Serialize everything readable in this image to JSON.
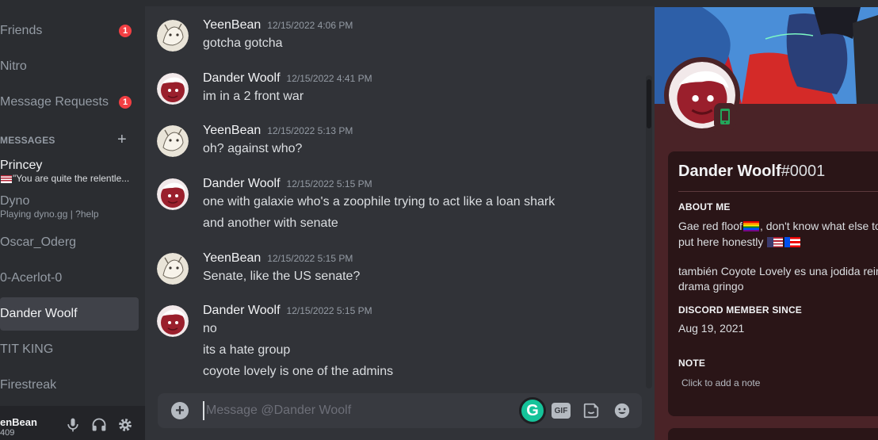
{
  "sidebar": {
    "nav": [
      {
        "label": "Friends",
        "badge": "1"
      },
      {
        "label": "Nitro",
        "badge": null
      },
      {
        "label": "Message Requests",
        "badge": "1"
      }
    ],
    "dm_header": "MESSAGES",
    "dms": [
      {
        "name": "Princey",
        "sub": "\"You are quite the relentle..."
      },
      {
        "name": "Dyno",
        "sub": "Playing dyno.gg | ?help"
      },
      {
        "name": "Oscar_Oderg",
        "sub": ""
      },
      {
        "name": "0-Acerlot-0",
        "sub": ""
      },
      {
        "name": "Dander Woolf",
        "sub": ""
      },
      {
        "name": "TIT KING",
        "sub": ""
      },
      {
        "name": "Firestreak",
        "sub": ""
      }
    ],
    "user": {
      "name": "enBean",
      "tag": "409"
    }
  },
  "messages": [
    {
      "author": "YeenBean",
      "time": "12/15/2022 4:06 PM",
      "lines": [
        "gotcha gotcha"
      ]
    },
    {
      "author": "Dander Woolf",
      "time": "12/15/2022 4:41 PM",
      "lines": [
        "im in a 2 front war"
      ]
    },
    {
      "author": "YeenBean",
      "time": "12/15/2022 5:13 PM",
      "lines": [
        "oh? against who?"
      ]
    },
    {
      "author": "Dander Woolf",
      "time": "12/15/2022 5:15 PM",
      "lines": [
        "one with galaxie who's a zoophile trying to act like a loan shark",
        "and another with senate"
      ]
    },
    {
      "author": "YeenBean",
      "time": "12/15/2022 5:15 PM",
      "lines": [
        "Senate, like the US senate?"
      ]
    },
    {
      "author": "Dander Woolf",
      "time": "12/15/2022 5:15 PM",
      "lines": [
        "no",
        "its a hate group",
        "coyote lovely is one of the admins"
      ]
    }
  ],
  "composer": {
    "placeholder": "Message @Dander Woolf",
    "gif_label": "GIF",
    "grammarly_label": "G"
  },
  "profile": {
    "username": "Dander Woolf",
    "discriminator": "#0001",
    "about_title": "ABOUT ME",
    "about_line1": "Gae red floof",
    "about_line1b": ", don't know what else to",
    "about_line2": " put here honestly",
    "about_line3": "también Coyote Lovely es una jodida reina",
    "about_line4": "drama gringo",
    "member_since_title": "DISCORD MEMBER SINCE",
    "member_since": "Aug 19, 2021",
    "note_title": "NOTE",
    "note_placeholder": "Click to add a note"
  },
  "colors": {
    "accent_red": "#f23f43",
    "grammarly": "#15c39a",
    "profile_bg": "#4a2327"
  }
}
